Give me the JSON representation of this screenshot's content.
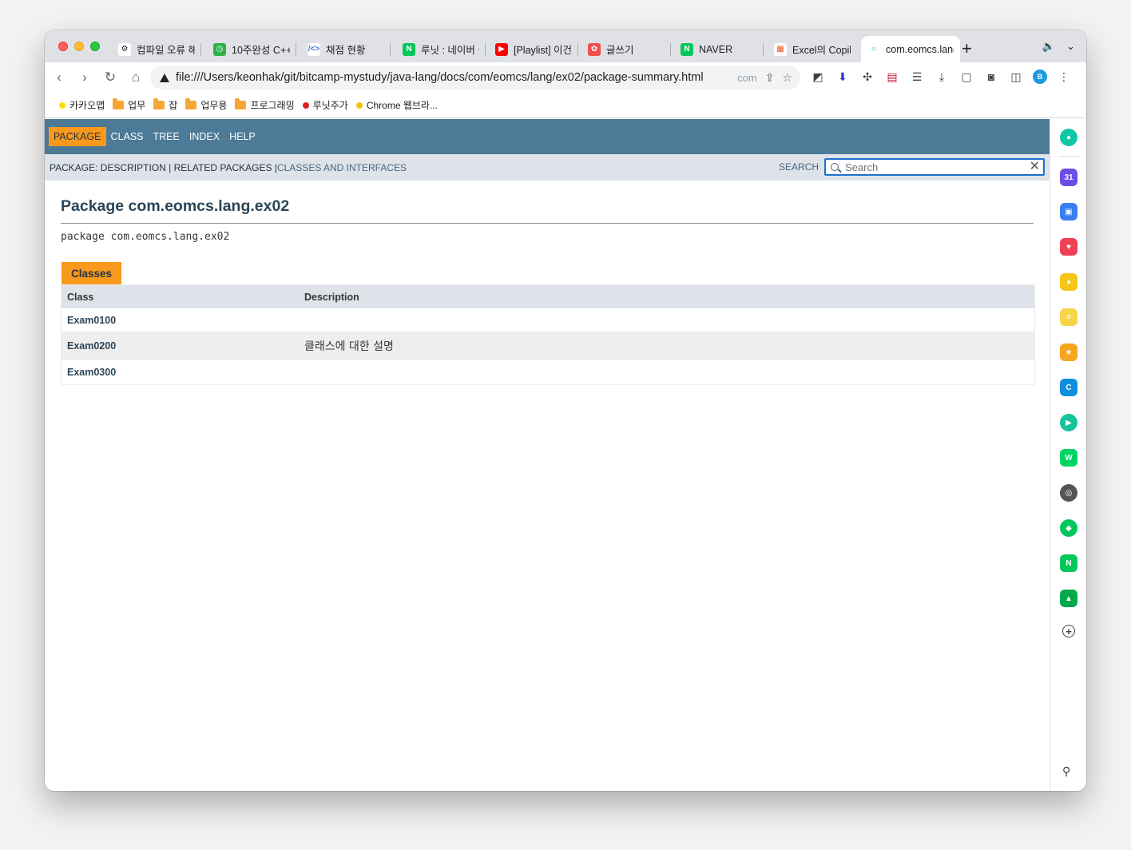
{
  "browser": {
    "tabs": [
      {
        "title": "컴파일 오류 해결",
        "fav_color": "#ffffff",
        "fav_glyph": "⚙",
        "fav_fg": "#202124"
      },
      {
        "title": "10주완성 C++",
        "fav_color": "#2db14b",
        "fav_glyph": "◷",
        "fav_fg": "#ffffff"
      },
      {
        "title": "채점 현황",
        "fav_color": "#ffffff",
        "fav_glyph": "/<>",
        "fav_fg": "#3b6fd8"
      },
      {
        "title": "루닛 : 네이버 증권",
        "fav_color": "#03c75a",
        "fav_glyph": "N",
        "fav_fg": "#ffffff"
      },
      {
        "title": "[Playlist] 이건",
        "fav_color": "#ff0000",
        "fav_glyph": "▶",
        "fav_fg": "#ffffff"
      },
      {
        "title": "글쓰기",
        "fav_color": "#f04e4e",
        "fav_glyph": "✿",
        "fav_fg": "#ffffff"
      },
      {
        "title": "NAVER",
        "fav_color": "#03c75a",
        "fav_glyph": "N",
        "fav_fg": "#ffffff"
      },
      {
        "title": "Excel의 Copilot",
        "fav_color": "#ffffff",
        "fav_glyph": "▦",
        "fav_fg": "#f25022"
      },
      {
        "title": "com.eomcs.lang",
        "fav_color": "#ffffff",
        "fav_glyph": "○",
        "fav_fg": "#00c4a0"
      }
    ],
    "new_tab_label": "+",
    "url": "file:///Users/keonhak/git/bitcamp-mystudy/java-lang/docs/com/eomcs/lang/ex02/package-summary.html",
    "url_suffix": "com",
    "profile_initial": "B",
    "bookmarks": [
      {
        "label": "카카오맵",
        "type": "dot",
        "color": "#fae100"
      },
      {
        "label": "업무",
        "type": "folder"
      },
      {
        "label": "잡",
        "type": "folder"
      },
      {
        "label": "업무용",
        "type": "folder"
      },
      {
        "label": "프로그래밍",
        "type": "folder"
      },
      {
        "label": "루닛주가",
        "type": "dot",
        "color": "#e02020"
      },
      {
        "label": "Chrome 웹브라...",
        "type": "dot",
        "color": "#f4c20d"
      }
    ]
  },
  "javadoc": {
    "nav": [
      "PACKAGE",
      "CLASS",
      "TREE",
      "INDEX",
      "HELP"
    ],
    "active_nav": "PACKAGE",
    "subnav_prefix": "PACKAGE: DESCRIPTION | RELATED PACKAGES | ",
    "subnav_link": "CLASSES AND INTERFACES",
    "search_label": "SEARCH",
    "search_placeholder": "Search",
    "title": "Package com.eomcs.lang.ex02",
    "declaration": "package com.eomcs.lang.ex02",
    "caption": "Classes",
    "col_class": "Class",
    "col_description": "Description",
    "rows": [
      {
        "name": "Exam0100",
        "description": ""
      },
      {
        "name": "Exam0200",
        "description": "클래스에 대한 설명"
      },
      {
        "name": "Exam0300",
        "description": ""
      }
    ]
  },
  "side_panel": [
    {
      "name": "whale-icon",
      "color": "#10c7a4",
      "glyph": "●"
    },
    {
      "name": "calendar-icon",
      "color": "#6c4de6",
      "glyph": "31"
    },
    {
      "name": "toolbox-icon",
      "color": "#3a7ff0",
      "glyph": "▣"
    },
    {
      "name": "pocket-icon",
      "color": "#ef4056",
      "glyph": "♥"
    },
    {
      "name": "map-pin-icon",
      "color": "#f5c518",
      "glyph": "●"
    },
    {
      "name": "notes-icon",
      "color": "#f7d54a",
      "glyph": "≡"
    },
    {
      "name": "star-icon",
      "color": "#f7a51f",
      "glyph": "★"
    },
    {
      "name": "translate-icon",
      "color": "#0e8fe0",
      "glyph": "C"
    },
    {
      "name": "play-icon",
      "color": "#15c39a",
      "glyph": "▶"
    },
    {
      "name": "webtoon-icon",
      "color": "#00d564",
      "glyph": "W"
    },
    {
      "name": "cube-icon",
      "color": "#555555",
      "glyph": "◎"
    },
    {
      "name": "bookmark-icon",
      "color": "#03c75a",
      "glyph": "◆"
    },
    {
      "name": "mail-icon",
      "color": "#03c75a",
      "glyph": "N"
    },
    {
      "name": "stock-icon",
      "color": "#03a94b",
      "glyph": "▲"
    },
    {
      "name": "add-icon",
      "color": "#ffffff",
      "glyph": "+"
    }
  ]
}
